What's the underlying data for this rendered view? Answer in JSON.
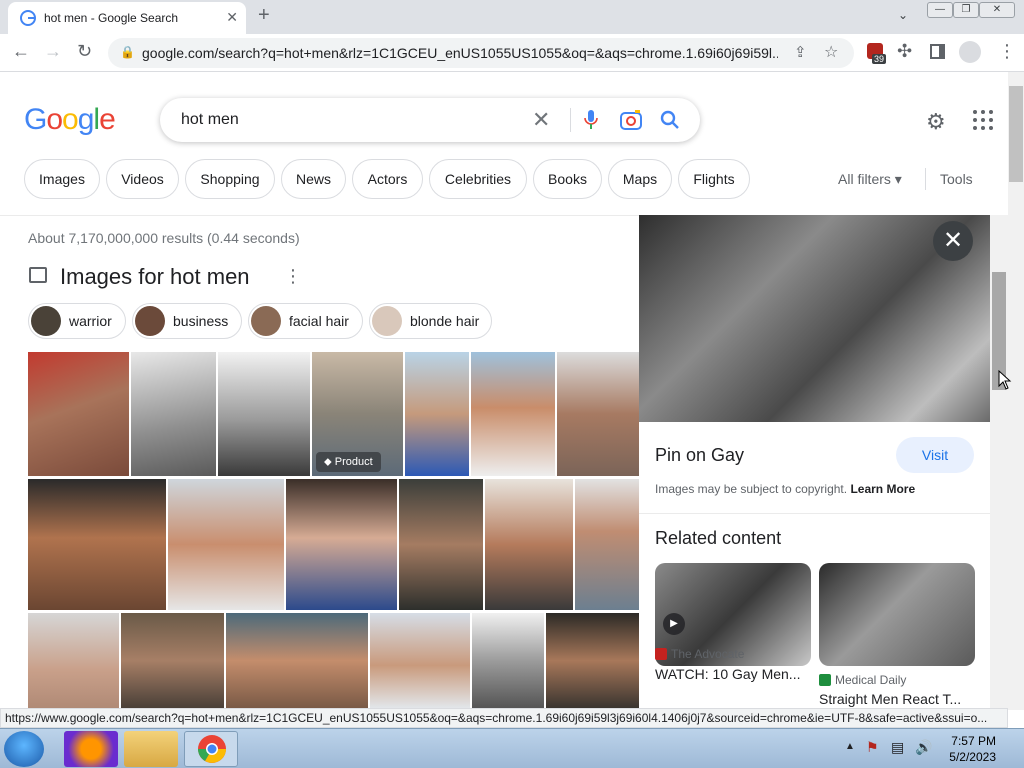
{
  "browser": {
    "tab_title": "hot men - Google Search",
    "url": "google.com/search?q=hot+men&rlz=1C1GCEU_enUS1055US1055&oq=&aqs=chrome.1.69i60j69i59l...",
    "extension_badge": "39",
    "status_url": "https://www.google.com/search?q=hot+men&rlz=1C1GCEU_enUS1055US1055&oq=&aqs=chrome.1.69i60j69i59l3j69i60l4.1406j0j7&sourceid=chrome&ie=UTF-8&safe=active&ssui=o..."
  },
  "google": {
    "logo": "Google",
    "query": "hot men",
    "chips": [
      "Images",
      "Videos",
      "Shopping",
      "News",
      "Actors",
      "Celebrities",
      "Books",
      "Maps",
      "Flights"
    ],
    "all_filters": "All filters",
    "tools": "Tools",
    "results_count": "About 7,170,000,000 results (0.44 seconds)",
    "images_heading": "Images for hot men",
    "refine_chips": [
      "warrior",
      "business",
      "facial hair",
      "blonde hair"
    ],
    "product_badge": "Product"
  },
  "panel": {
    "pin_title": "Pin on Gay",
    "visit": "Visit",
    "copyright": "Images may be subject to copyright.",
    "learn_more": "Learn More",
    "related_heading": "Related content",
    "related": [
      {
        "source": "The Advocate",
        "title": "WATCH: 10 Gay Men..."
      },
      {
        "source": "Medical Daily",
        "title": "Straight Men React T..."
      }
    ]
  },
  "taskbar": {
    "time": "7:57 PM",
    "date": "5/2/2023"
  },
  "colors": {
    "google_blue": "#4285F4",
    "google_red": "#EA4335",
    "google_yellow": "#FBBC05",
    "google_green": "#34A853"
  }
}
